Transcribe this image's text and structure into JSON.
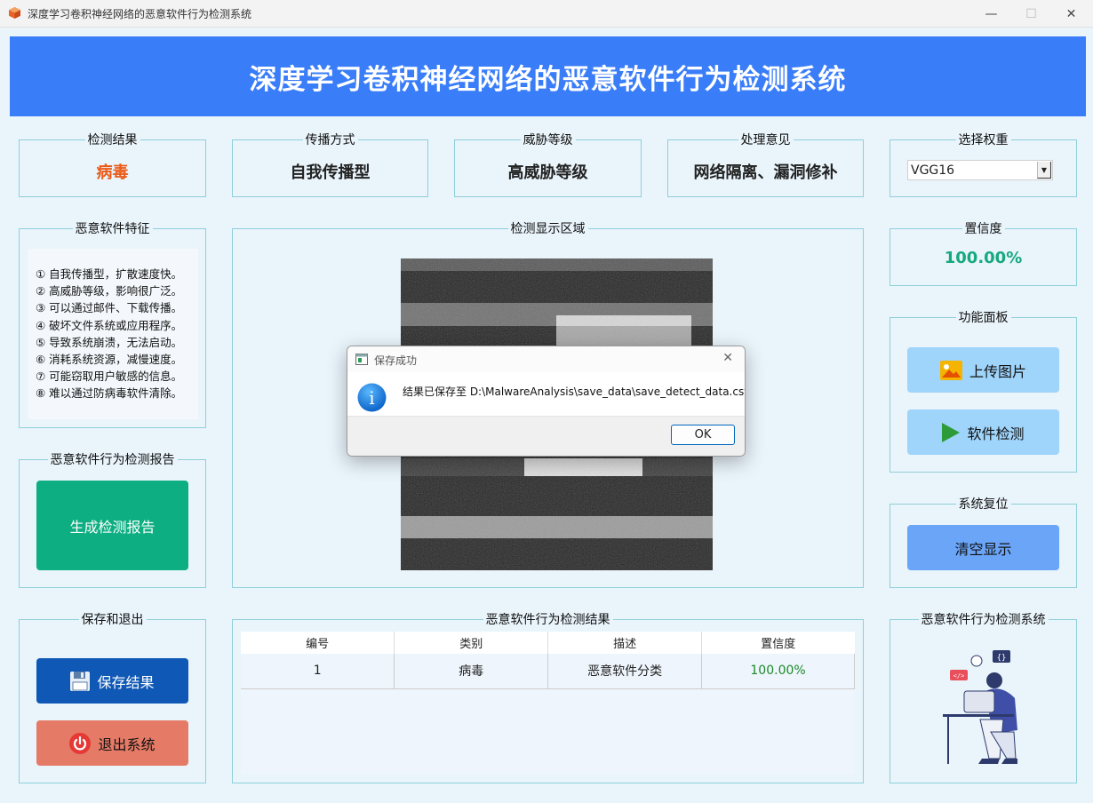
{
  "window": {
    "title": "深度学习卷积神经网络的恶意软件行为检测系统",
    "minimize": "—",
    "maximize": "☐",
    "close": "✕"
  },
  "banner": {
    "title": "深度学习卷积神经网络的恶意软件行为检测系统"
  },
  "info": {
    "detect_result": {
      "label": "检测结果",
      "value": "病毒",
      "color": "#ea5a16"
    },
    "spread": {
      "label": "传播方式",
      "value": "自我传播型"
    },
    "threat": {
      "label": "威胁等级",
      "value": "高威胁等级"
    },
    "advice": {
      "label": "处理意见",
      "value": "网络隔离、漏洞修补"
    },
    "weights": {
      "label": "选择权重",
      "value": "VGG16"
    }
  },
  "features": {
    "label": "恶意软件特征",
    "items": [
      "① 自我传播型，扩散速度快。",
      "② 高威胁等级，影响很广泛。",
      "③ 可以通过邮件、下载传播。",
      "④ 破坏文件系统或应用程序。",
      "⑤ 导致系统崩溃，无法启动。",
      "⑥ 消耗系统资源，减慢速度。",
      "⑦ 可能窃取用户敏感的信息。",
      "⑧ 难以通过防病毒软件清除。"
    ]
  },
  "report": {
    "label": "恶意软件行为检测报告",
    "button": "生成检测报告"
  },
  "display": {
    "label": "检测显示区域"
  },
  "confidence": {
    "label": "置信度",
    "value": "100.00%",
    "color": "#16a97f"
  },
  "functions": {
    "label": "功能面板",
    "upload": "上传图片",
    "detect": "软件检测"
  },
  "reset": {
    "label": "系统复位",
    "clear": "清空显示"
  },
  "save_exit": {
    "label": "保存和退出",
    "save": "保存结果",
    "exit": "退出系统"
  },
  "results": {
    "label": "恶意软件行为检测结果",
    "columns": [
      "编号",
      "类别",
      "描述",
      "置信度"
    ],
    "rows": [
      {
        "id": "1",
        "category": "病毒",
        "desc": "恶意软件分类",
        "conf": "100.00%"
      }
    ]
  },
  "system_panel": {
    "label": "恶意软件行为检测系统"
  },
  "dialog": {
    "title": "保存成功",
    "message": "结果已保存至 D:\\MalwareAnalysis\\save_data\\save_detect_data.csv",
    "ok": "OK",
    "info_glyph": "i",
    "close": "✕"
  },
  "colors": {
    "banner": "#3a7df9",
    "report_btn": "#0dae82",
    "light_btn": "#9fd4fb",
    "clear_btn": "#6aa5f8",
    "save_btn": "#0f58b5",
    "exit_btn": "#e57a66",
    "table_conf": "#1b8a2a"
  }
}
